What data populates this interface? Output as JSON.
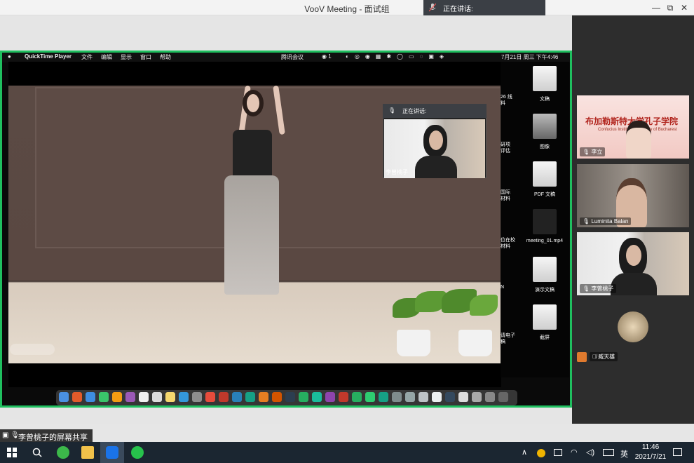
{
  "window": {
    "title": "VooV Meeting - 面试组"
  },
  "speaking_top": {
    "label": "正在讲话:"
  },
  "window_buttons": {
    "minimize": "—",
    "restore": "⧉",
    "close": "✕"
  },
  "mac_menubar": {
    "app": "QuickTime Player",
    "menus": [
      "文件",
      "编辑",
      "显示",
      "窗口",
      "帮助"
    ],
    "status": "腾讯会议",
    "clock": "7月21日 周三 下午4:46"
  },
  "inset": {
    "header": "正在讲话:",
    "name": "李曾桃子"
  },
  "desktop_icons": [
    {
      "label": "文稿"
    },
    {
      "label": "图像"
    },
    {
      "label": "PDF 文稿"
    },
    {
      "label": "meeting_01.mp4"
    },
    {
      "label": "演示文稿"
    },
    {
      "label": "截屏"
    }
  ],
  "left_partial_labels": [
    "26 线",
    "料",
    "研项",
    "评估",
    "国际",
    "材料",
    "位在校",
    "材料",
    "N",
    "请电子",
    "稿"
  ],
  "share_label": {
    "text": "李曾桃子的屏幕共享"
  },
  "participants": [
    {
      "name": "李立",
      "banner_title": "布加勒斯特大学孔子学院",
      "banner_sub": "Confucius Institute University of Bucharest",
      "muted": false
    },
    {
      "name": "Luminita Balan",
      "muted": false
    },
    {
      "name": "李曾桃子",
      "muted": false
    },
    {
      "name": "臧天雄",
      "muted": true
    }
  ],
  "taskbar": {
    "time": "11:46",
    "date": "2021/7/21",
    "ime": "英"
  },
  "colors": {
    "share_border": "#1fbf5f",
    "taskbar_bg": "#1b2631"
  }
}
